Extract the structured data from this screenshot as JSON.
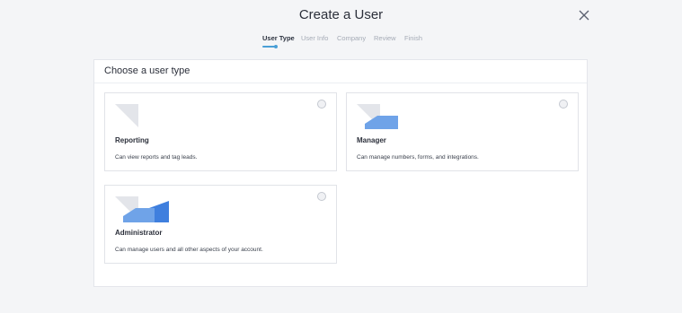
{
  "header": {
    "title": "Create a User"
  },
  "steps": [
    {
      "label": "User Type",
      "active": true
    },
    {
      "label": "User Info",
      "active": false
    },
    {
      "label": "Company",
      "active": false
    },
    {
      "label": "Review",
      "active": false
    },
    {
      "label": "Finish",
      "active": false
    }
  ],
  "main": {
    "section_title": "Choose a user type",
    "options": [
      {
        "name": "Reporting",
        "description": "Can view reports and tag leads.",
        "icon": "reporting-illustration",
        "selected": false
      },
      {
        "name": "Manager",
        "description": "Can manage numbers, forms, and integrations.",
        "icon": "manager-illustration",
        "selected": false
      },
      {
        "name": "Administrator",
        "description": "Can manage users and all other aspects of your account.",
        "icon": "administrator-illustration",
        "selected": false
      }
    ]
  },
  "colors": {
    "accent": "#4a9fd6",
    "illustration_blue": "#6fa3e8",
    "illustration_blue_dark": "#3f7fde",
    "illustration_gray": "#e3e5ea"
  }
}
